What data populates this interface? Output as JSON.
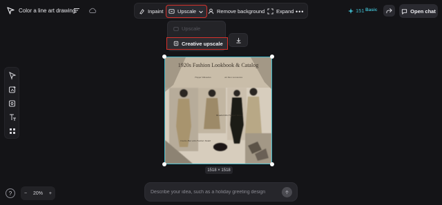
{
  "header": {
    "doc_title": "Color a line art drawing",
    "icons": [
      "app-logo",
      "hamburger-menu-icon",
      "cloud-sync-icon"
    ]
  },
  "toolbar": {
    "inpaint_label": "Inpaint",
    "upscale_label": "Upscale",
    "remove_background_label": "Remove background",
    "expand_label": "Expand",
    "more_label": "•••"
  },
  "account": {
    "credits": "151",
    "plan": "Basic",
    "open_chat_label": "Open chat"
  },
  "upscale_menu": {
    "items": [
      {
        "label": "Upscale",
        "disabled": true
      },
      {
        "label": "Creative upscale",
        "disabled": false,
        "highlighted": true
      }
    ]
  },
  "left_tools": [
    "select-tool-icon",
    "add-image-icon",
    "image-settings-icon",
    "text-tool-icon",
    "grid-tool-icon"
  ],
  "canvas": {
    "image_title": "1920s Fashion Lookbook & Catalog",
    "image_subtitle_left": "Flapper Silhouettes",
    "image_subtitle_right": "Art Deco Accessories",
    "image_caption_1": "Beaded Silk Flapper Dress",
    "image_caption_2": "Cloche Hat with Feather Detail",
    "size_label": "1518 × 1518"
  },
  "zoom": {
    "minus": "−",
    "value": "20%",
    "plus": "+"
  },
  "help_label": "?",
  "prompt": {
    "placeholder": "Describe your idea, such as a holiday greeting design"
  },
  "colors": {
    "accent": "#3fb7c9",
    "highlight": "#d9322c",
    "background": "#141417"
  }
}
